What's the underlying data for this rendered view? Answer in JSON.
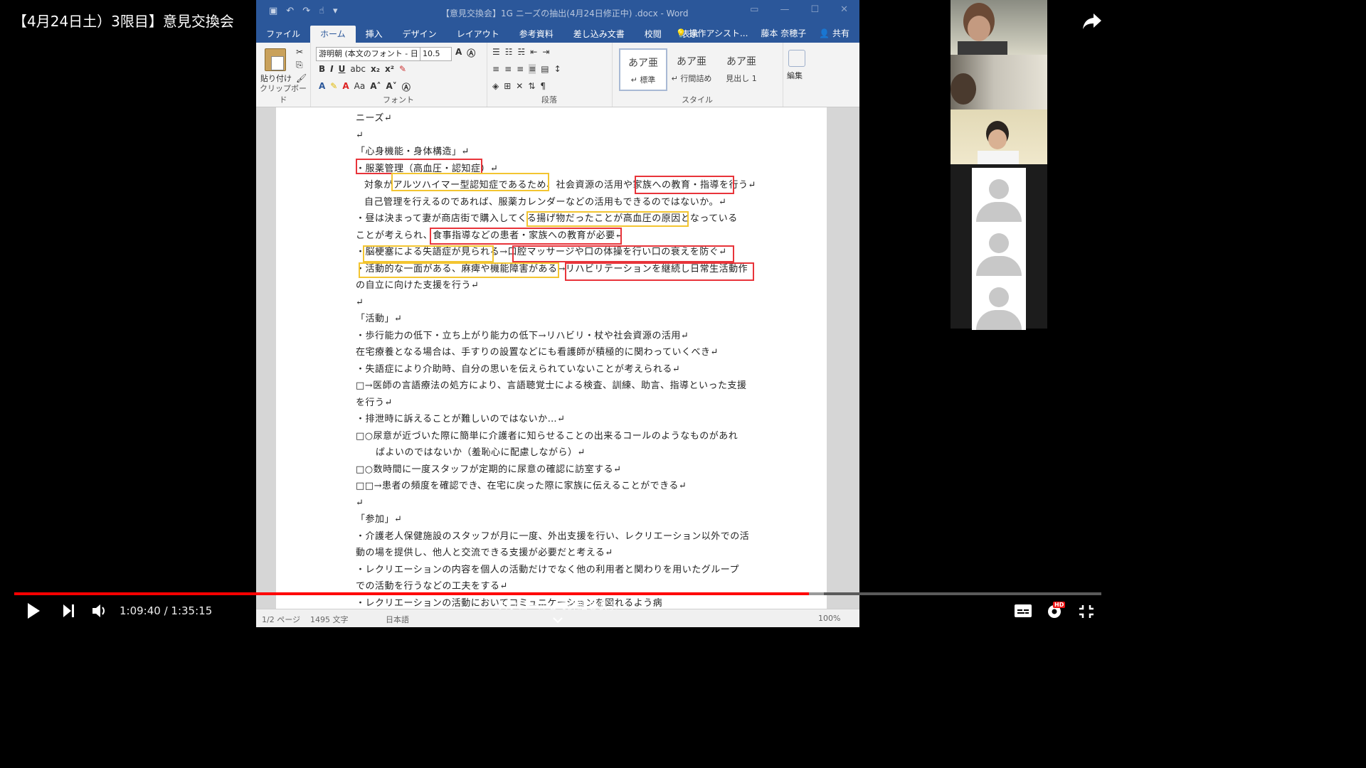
{
  "video": {
    "title": "【4月24日土）3限目】意見交換会",
    "time": "1:09:40 / 1:35:15",
    "progress_fraction": 0.731,
    "buffered_fraction": 0.745,
    "scroll_hint": "スクロールして詳細を表示"
  },
  "word": {
    "doc_title": "【意見交換会】1G ニーズの抽出(4月24日修正中) .docx - Word",
    "tabs": [
      "ファイル",
      "ホーム",
      "挿入",
      "デザイン",
      "レイアウト",
      "参考資料",
      "差し込み文書",
      "校閲",
      "表示"
    ],
    "active_tab": "ホーム",
    "tell_me": "操作アシスト...",
    "user": "藤本 奈穂子",
    "share": "共有",
    "ribbon": {
      "clipboard_label": "クリップボード",
      "paste_label": "貼り付け",
      "font_label": "フォント",
      "font_name": "游明朝 (本文のフォント - 日",
      "font_size": "10.5",
      "paragraph_label": "段落",
      "style_label": "スタイル",
      "styles": [
        {
          "sample": "あア亜",
          "name": "↵ 標準"
        },
        {
          "sample": "あア亜",
          "name": "↵ 行間詰め"
        },
        {
          "sample": "あア亜",
          "name": "見出し 1"
        }
      ],
      "edit_label": "編集"
    },
    "status": {
      "page": "1/2 ページ",
      "words": "1495 文字",
      "lang": "日本語",
      "zoom": "100%"
    }
  },
  "document": {
    "lines": [
      {
        "text": "ニーズ↵",
        "indent": 0
      },
      {
        "text": "↵",
        "indent": 0
      },
      {
        "text": "「心身機能・身体構造」↵",
        "indent": 0
      },
      {
        "text": "・服薬管理（高血圧・認知症）↵",
        "indent": 0
      },
      {
        "text": "対象がアルツハイマー型認知症であるため、社会資源の活用や家族への教育・指導を行う↵",
        "indent": 1
      },
      {
        "text": "自己管理を行えるのであれば、服薬カレンダーなどの活用もできるのではないか。↵",
        "indent": 1
      },
      {
        "text": "・昼は決まって妻が商店街で購入してくる揚げ物だったことが高血圧の原因となっている",
        "indent": 0
      },
      {
        "text": "ことが考えられ、食事指導などの患者・家族への教育が必要↵",
        "indent": 0
      },
      {
        "text": "・脳梗塞による失語症が見られる→口腔マッサージや口の体操を行い口の衰えを防ぐ↵",
        "indent": 0
      },
      {
        "text": "・活動的な一面がある、麻痺や機能障害がある→リハビリテーションを継続し日常生活動作",
        "indent": 0
      },
      {
        "text": "の自立に向けた支援を行う↵",
        "indent": 0
      },
      {
        "text": "↵",
        "indent": 0
      },
      {
        "text": "「活動」↵",
        "indent": 0
      },
      {
        "text": "・歩行能力の低下・立ち上がり能力の低下→リハビリ・杖や社会資源の活用↵",
        "indent": 0
      },
      {
        "text": "在宅療養となる場合は、手すりの設置などにも看護師が積極的に関わっていくべき↵",
        "indent": 0
      },
      {
        "text": "・失語症により介助時、自分の思いを伝えられていないことが考えられる↵",
        "indent": 0
      },
      {
        "text": "□→医師の言語療法の処方により、言語聴覚士による検査、訓練、助言、指導といった支援",
        "indent": 0
      },
      {
        "text": "を行う↵",
        "indent": 0
      },
      {
        "text": "・排泄時に訴えることが難しいのではないか…↵",
        "indent": 0
      },
      {
        "text": "□○尿意が近づいた際に簡単に介護者に知らせることの出来るコールのようなものがあれ",
        "indent": 0
      },
      {
        "text": "ばよいのではないか（羞恥心に配慮しながら）↵",
        "indent": 2
      },
      {
        "text": "□○数時間に一度スタッフが定期的に尿意の確認に訪室する↵",
        "indent": 0
      },
      {
        "text": "□□→患者の頻度を確認でき、在宅に戻った際に家族に伝えることができる↵",
        "indent": 0
      },
      {
        "text": "↵",
        "indent": 0
      },
      {
        "text": "「参加」↵",
        "indent": 0
      },
      {
        "text": "・介護老人保健施設のスタッフが月に一度、外出支援を行い、レクリエーション以外での活",
        "indent": 0
      },
      {
        "text": "動の場を提供し、他人と交流できる支援が必要だと考える↵",
        "indent": 0
      },
      {
        "text": "・レクリエーションの内容を個人の活動だけでなく他の利用者と関わりを用いたグループ",
        "indent": 0
      },
      {
        "text": "での活動を行うなどの工夫をする↵",
        "indent": 0
      },
      {
        "text": "・レクリエーションの活動においてコミュニケーションを図れるよう病",
        "indent": 0
      }
    ]
  },
  "participants": {
    "video_tiles": 3,
    "avatar_tiles": 3
  },
  "colors": {
    "word_blue": "#2b579a",
    "annotation_red": "#e8343a",
    "annotation_yellow": "#f3c531",
    "progress_red": "#ff0000"
  },
  "icons": [
    "share-icon",
    "play-icon",
    "next-icon",
    "volume-icon",
    "captions-icon",
    "settings-icon",
    "fullscreen-exit-icon",
    "chevron-down-icon"
  ]
}
